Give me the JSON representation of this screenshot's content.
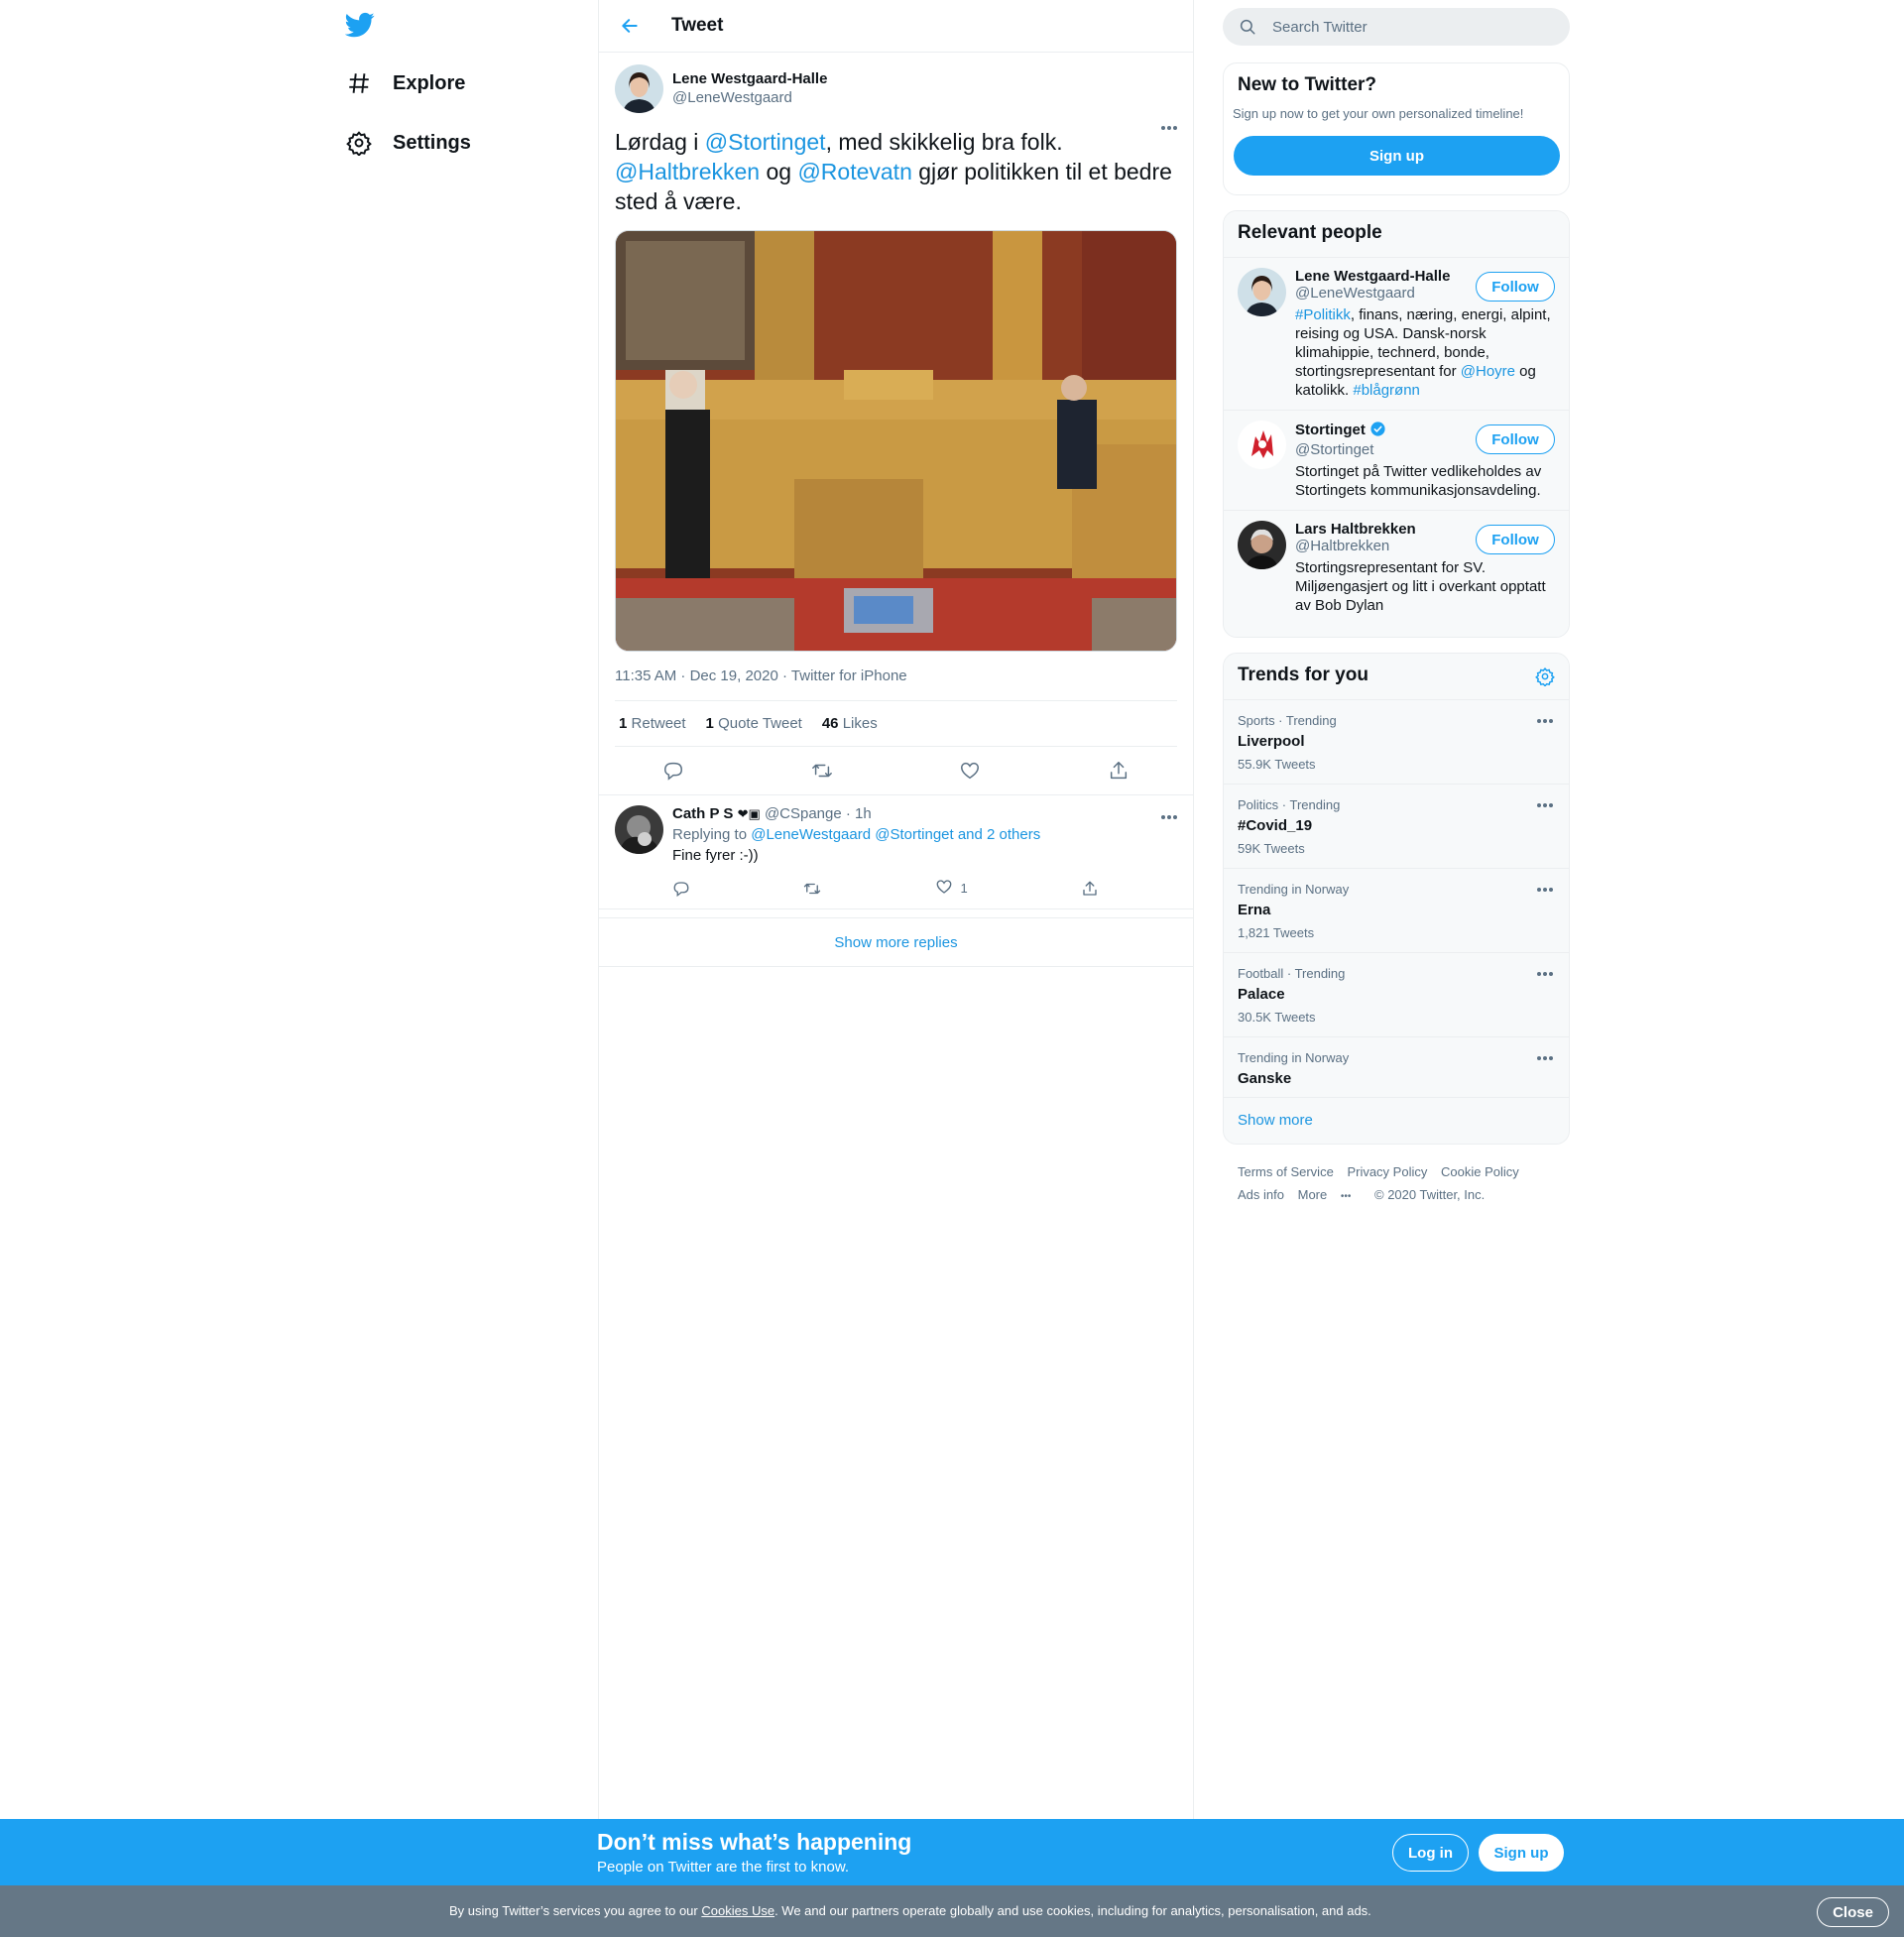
{
  "nav": {
    "explore_label": "Explore",
    "settings_label": "Settings"
  },
  "header": {
    "title": "Tweet"
  },
  "tweet": {
    "author_name": "Lene Westgaard-Halle",
    "author_handle": "@LeneWestgaard",
    "text_parts": {
      "t1": "Lørdag i ",
      "m1": "@Stortinget",
      "t2": ", med skikkelig bra folk.",
      "m2": "@Haltbrekken",
      "t3": " og ",
      "m3": "@Rotevatn",
      "t4": " gjør politikken til et bedre sted å være."
    },
    "time": "11:35 AM · Dec 19, 2020",
    "source": "Twitter for iPhone",
    "retweets": "1",
    "retweets_label": "Retweet",
    "quotes": "1",
    "quotes_label": "Quote Tweet",
    "likes": "46",
    "likes_label": "Likes"
  },
  "reply": {
    "name": "Cath P S",
    "handle": "@CSpange",
    "time": "· 1h",
    "replying_prefix": "Replying to",
    "replying_to": "@LeneWestgaard @Stortinget and 2 others",
    "text": "Fine fyrer :-))",
    "like_count": "1"
  },
  "show_more_replies": "Show more replies",
  "search": {
    "placeholder": "Search Twitter"
  },
  "new_to_twitter": {
    "title": "New to Twitter?",
    "subtitle": "Sign up now to get your own personalized timeline!",
    "button": "Sign up"
  },
  "relevant_people": {
    "title": "Relevant people",
    "follow_label": "Follow",
    "people": [
      {
        "name": "Lene Westgaard-Halle",
        "handle": "@LeneWestgaard",
        "bio_tag1": "#Politikk",
        "bio_text1": ", finans, næring, energi, alpint, reising og USA. Dansk-norsk klimahippie, technerd, bonde, stortingsrepresentant for ",
        "bio_tag2": "@Hoyre",
        "bio_text2": " og katolikk. ",
        "bio_tag3": "#blågrønn"
      },
      {
        "name": "Stortinget",
        "handle": "@Stortinget",
        "bio": "Stortinget på Twitter vedlikeholdes av Stortingets kommunikasjonsavdeling."
      },
      {
        "name": "Lars Haltbrekken",
        "handle": "@Haltbrekken",
        "bio": "Stortingsrepresentant for SV. Miljøengasjert og litt i overkant opptatt av Bob Dylan"
      }
    ]
  },
  "trends": {
    "title": "Trends for you",
    "items": [
      {
        "context": "Sports · Trending",
        "name": "Liverpool",
        "count": "55.9K Tweets"
      },
      {
        "context": "Politics · Trending",
        "name": "#Covid_19",
        "count": "59K Tweets"
      },
      {
        "context": "Trending in Norway",
        "name": "Erna",
        "count": "1,821 Tweets"
      },
      {
        "context": "Football · Trending",
        "name": "Palace",
        "count": "30.5K Tweets"
      },
      {
        "context": "Trending in Norway",
        "name": "Ganske",
        "count": ""
      }
    ],
    "show_more": "Show more"
  },
  "footer": {
    "terms": "Terms of Service",
    "privacy": "Privacy Policy",
    "cookie": "Cookie Policy",
    "ads": "Ads info",
    "more": "More",
    "copyright": "© 2020 Twitter, Inc."
  },
  "bottom_bar": {
    "headline": "Don’t miss what’s happening",
    "subline": "People on Twitter are the first to know.",
    "login": "Log in",
    "signup": "Sign up"
  },
  "cookie_bar": {
    "text_before": "By using Twitter’s services you agree to our ",
    "link": "Cookies Use",
    "text_after": ". We and our partners operate globally and use cookies, including for analytics, personalisation, and ads.",
    "close": "Close"
  },
  "colors": {
    "accent": "#1da1f2",
    "link": "#1b95e0",
    "secondary_text": "#5b7083",
    "cookie_bar": "#657786"
  }
}
